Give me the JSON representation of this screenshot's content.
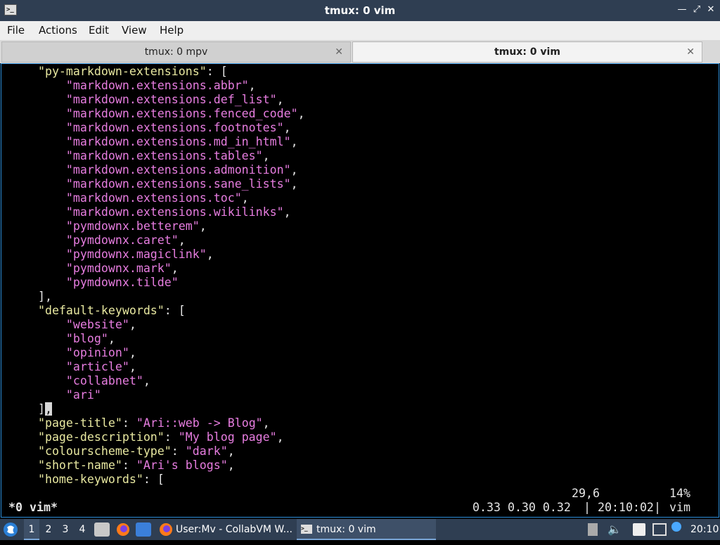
{
  "window": {
    "title": "tmux: 0 vim",
    "icon": "terminal-icon",
    "controls": [
      "minimize-icon",
      "maximize-icon",
      "close-icon"
    ]
  },
  "menu": [
    "File",
    "Actions",
    "Edit",
    "View",
    "Help"
  ],
  "tabs": [
    {
      "label": "tmux: 0 mpv",
      "active": false
    },
    {
      "label": "tmux: 0 vim",
      "active": true
    }
  ],
  "editor": {
    "lines": [
      [
        {
          "t": "    \"py-markdown-extensions\"",
          "c": "k"
        },
        {
          "t": ": [",
          "c": "p"
        }
      ],
      [
        {
          "t": "        \"markdown.extensions.abbr\"",
          "c": "s"
        },
        {
          "t": ",",
          "c": "p"
        }
      ],
      [
        {
          "t": "        \"markdown.extensions.def_list\"",
          "c": "s"
        },
        {
          "t": ",",
          "c": "p"
        }
      ],
      [
        {
          "t": "        \"markdown.extensions.fenced_code\"",
          "c": "s"
        },
        {
          "t": ",",
          "c": "p"
        }
      ],
      [
        {
          "t": "        \"markdown.extensions.footnotes\"",
          "c": "s"
        },
        {
          "t": ",",
          "c": "p"
        }
      ],
      [
        {
          "t": "        \"markdown.extensions.md_in_html\"",
          "c": "s"
        },
        {
          "t": ",",
          "c": "p"
        }
      ],
      [
        {
          "t": "        \"markdown.extensions.tables\"",
          "c": "s"
        },
        {
          "t": ",",
          "c": "p"
        }
      ],
      [
        {
          "t": "        \"markdown.extensions.admonition\"",
          "c": "s"
        },
        {
          "t": ",",
          "c": "p"
        }
      ],
      [
        {
          "t": "        \"markdown.extensions.sane_lists\"",
          "c": "s"
        },
        {
          "t": ",",
          "c": "p"
        }
      ],
      [
        {
          "t": "        \"markdown.extensions.toc\"",
          "c": "s"
        },
        {
          "t": ",",
          "c": "p"
        }
      ],
      [
        {
          "t": "        \"markdown.extensions.wikilinks\"",
          "c": "s"
        },
        {
          "t": ",",
          "c": "p"
        }
      ],
      [
        {
          "t": "        \"pymdownx.betterem\"",
          "c": "s"
        },
        {
          "t": ",",
          "c": "p"
        }
      ],
      [
        {
          "t": "        \"pymdownx.caret\"",
          "c": "s"
        },
        {
          "t": ",",
          "c": "p"
        }
      ],
      [
        {
          "t": "        \"pymdownx.magiclink\"",
          "c": "s"
        },
        {
          "t": ",",
          "c": "p"
        }
      ],
      [
        {
          "t": "        \"pymdownx.mark\"",
          "c": "s"
        },
        {
          "t": ",",
          "c": "p"
        }
      ],
      [
        {
          "t": "        \"pymdownx.tilde\"",
          "c": "s"
        }
      ],
      [
        {
          "t": "    ],",
          "c": "p"
        }
      ],
      [
        {
          "t": "    \"default-keywords\"",
          "c": "k"
        },
        {
          "t": ": [",
          "c": "p"
        }
      ],
      [
        {
          "t": "        \"website\"",
          "c": "s"
        },
        {
          "t": ",",
          "c": "p"
        }
      ],
      [
        {
          "t": "        \"blog\"",
          "c": "s"
        },
        {
          "t": ",",
          "c": "p"
        }
      ],
      [
        {
          "t": "        \"opinion\"",
          "c": "s"
        },
        {
          "t": ",",
          "c": "p"
        }
      ],
      [
        {
          "t": "        \"article\"",
          "c": "s"
        },
        {
          "t": ",",
          "c": "p"
        }
      ],
      [
        {
          "t": "        \"collabnet\"",
          "c": "s"
        },
        {
          "t": ",",
          "c": "p"
        }
      ],
      [
        {
          "t": "        \"ari\"",
          "c": "s"
        }
      ],
      [
        {
          "t": "    ]",
          "c": "p"
        },
        {
          "t": ",",
          "c": "cursor"
        }
      ],
      [
        {
          "t": "    \"page-title\"",
          "c": "k"
        },
        {
          "t": ": ",
          "c": "p"
        },
        {
          "t": "\"Ari::web -> Blog\"",
          "c": "s"
        },
        {
          "t": ",",
          "c": "p"
        }
      ],
      [
        {
          "t": "    \"page-description\"",
          "c": "k"
        },
        {
          "t": ": ",
          "c": "p"
        },
        {
          "t": "\"My blog page\"",
          "c": "s"
        },
        {
          "t": ",",
          "c": "p"
        }
      ],
      [
        {
          "t": "    \"colourscheme-type\"",
          "c": "k"
        },
        {
          "t": ": ",
          "c": "p"
        },
        {
          "t": "\"dark\"",
          "c": "s"
        },
        {
          "t": ",",
          "c": "p"
        }
      ],
      [
        {
          "t": "    \"short-name\"",
          "c": "k"
        },
        {
          "t": ": ",
          "c": "p"
        },
        {
          "t": "\"Ari's blogs\"",
          "c": "s"
        },
        {
          "t": ",",
          "c": "p"
        }
      ],
      [
        {
          "t": "    \"home-keywords\"",
          "c": "k"
        },
        {
          "t": ": [",
          "c": "p"
        }
      ]
    ],
    "ruler_position": "29,6",
    "ruler_percent": "14%"
  },
  "tmux_status": {
    "window": "*0 vim*",
    "load": "0.33 0.30 0.32",
    "separator": "|",
    "time": "20:10:02",
    "app": "vim"
  },
  "taskbar": {
    "menu_icon": "start-menu-icon",
    "workspaces": [
      "1",
      "2",
      "3",
      "4"
    ],
    "active_workspace": "1",
    "launchers": [
      "file-manager-icon",
      "firefox-icon",
      "desktop-icon"
    ],
    "windows": [
      {
        "label": "User:Mv - CollabVM W...",
        "icon": "firefox-icon",
        "active": false
      },
      {
        "label": "tmux: 0 vim",
        "icon": "terminal-icon",
        "active": true
      }
    ],
    "tray": [
      "eject-icon",
      "volume-icon",
      "clipboard-icon",
      "network-icon",
      "notification-icon"
    ],
    "clock": "20:10"
  },
  "colors": {
    "titlebar": "#2f3e52",
    "key": "#e8e8a0",
    "string": "#e77de0",
    "text": "#e6e6e6",
    "terminal_border": "#2c8fdc"
  }
}
